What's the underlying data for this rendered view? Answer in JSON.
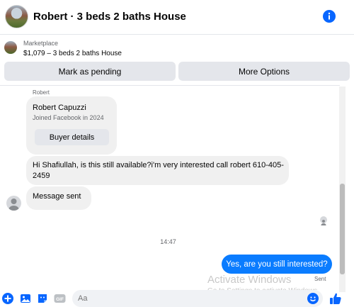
{
  "header": {
    "title": "Robert · 3 beds 2 baths House"
  },
  "marketplace": {
    "label": "Marketplace",
    "listing": "$1,079 – 3 beds 2 baths House"
  },
  "actions": {
    "mark_pending": "Mark as pending",
    "more_options": "More Options"
  },
  "conversation": {
    "sender_name": "Robert",
    "card": {
      "name": "Robert Capuzzi",
      "joined": "Joined Facebook in 2024",
      "button": "Buyer details"
    },
    "incoming_message": "Hi Shafiullah, is this still available?i'm very interested  call robert 610-405-2459",
    "system_message": "Message sent",
    "timestamp": "14:47",
    "outgoing_message": "Yes, are you still interested?",
    "outgoing_status": "Sent"
  },
  "watermark": {
    "line1": "Activate Windows",
    "line2": "Go to Settings to activate Windows."
  },
  "composer": {
    "placeholder": "Aa",
    "icons": [
      "plus-circle-icon",
      "image-icon",
      "sticker-icon",
      "gif-icon",
      "emoji-icon",
      "thumbs-up-icon"
    ]
  },
  "colors": {
    "accent": "#0a7cff",
    "bubble_incoming": "#f0f0f0",
    "button_bg": "#e4e6eb",
    "icon_blue": "#0866ff"
  }
}
